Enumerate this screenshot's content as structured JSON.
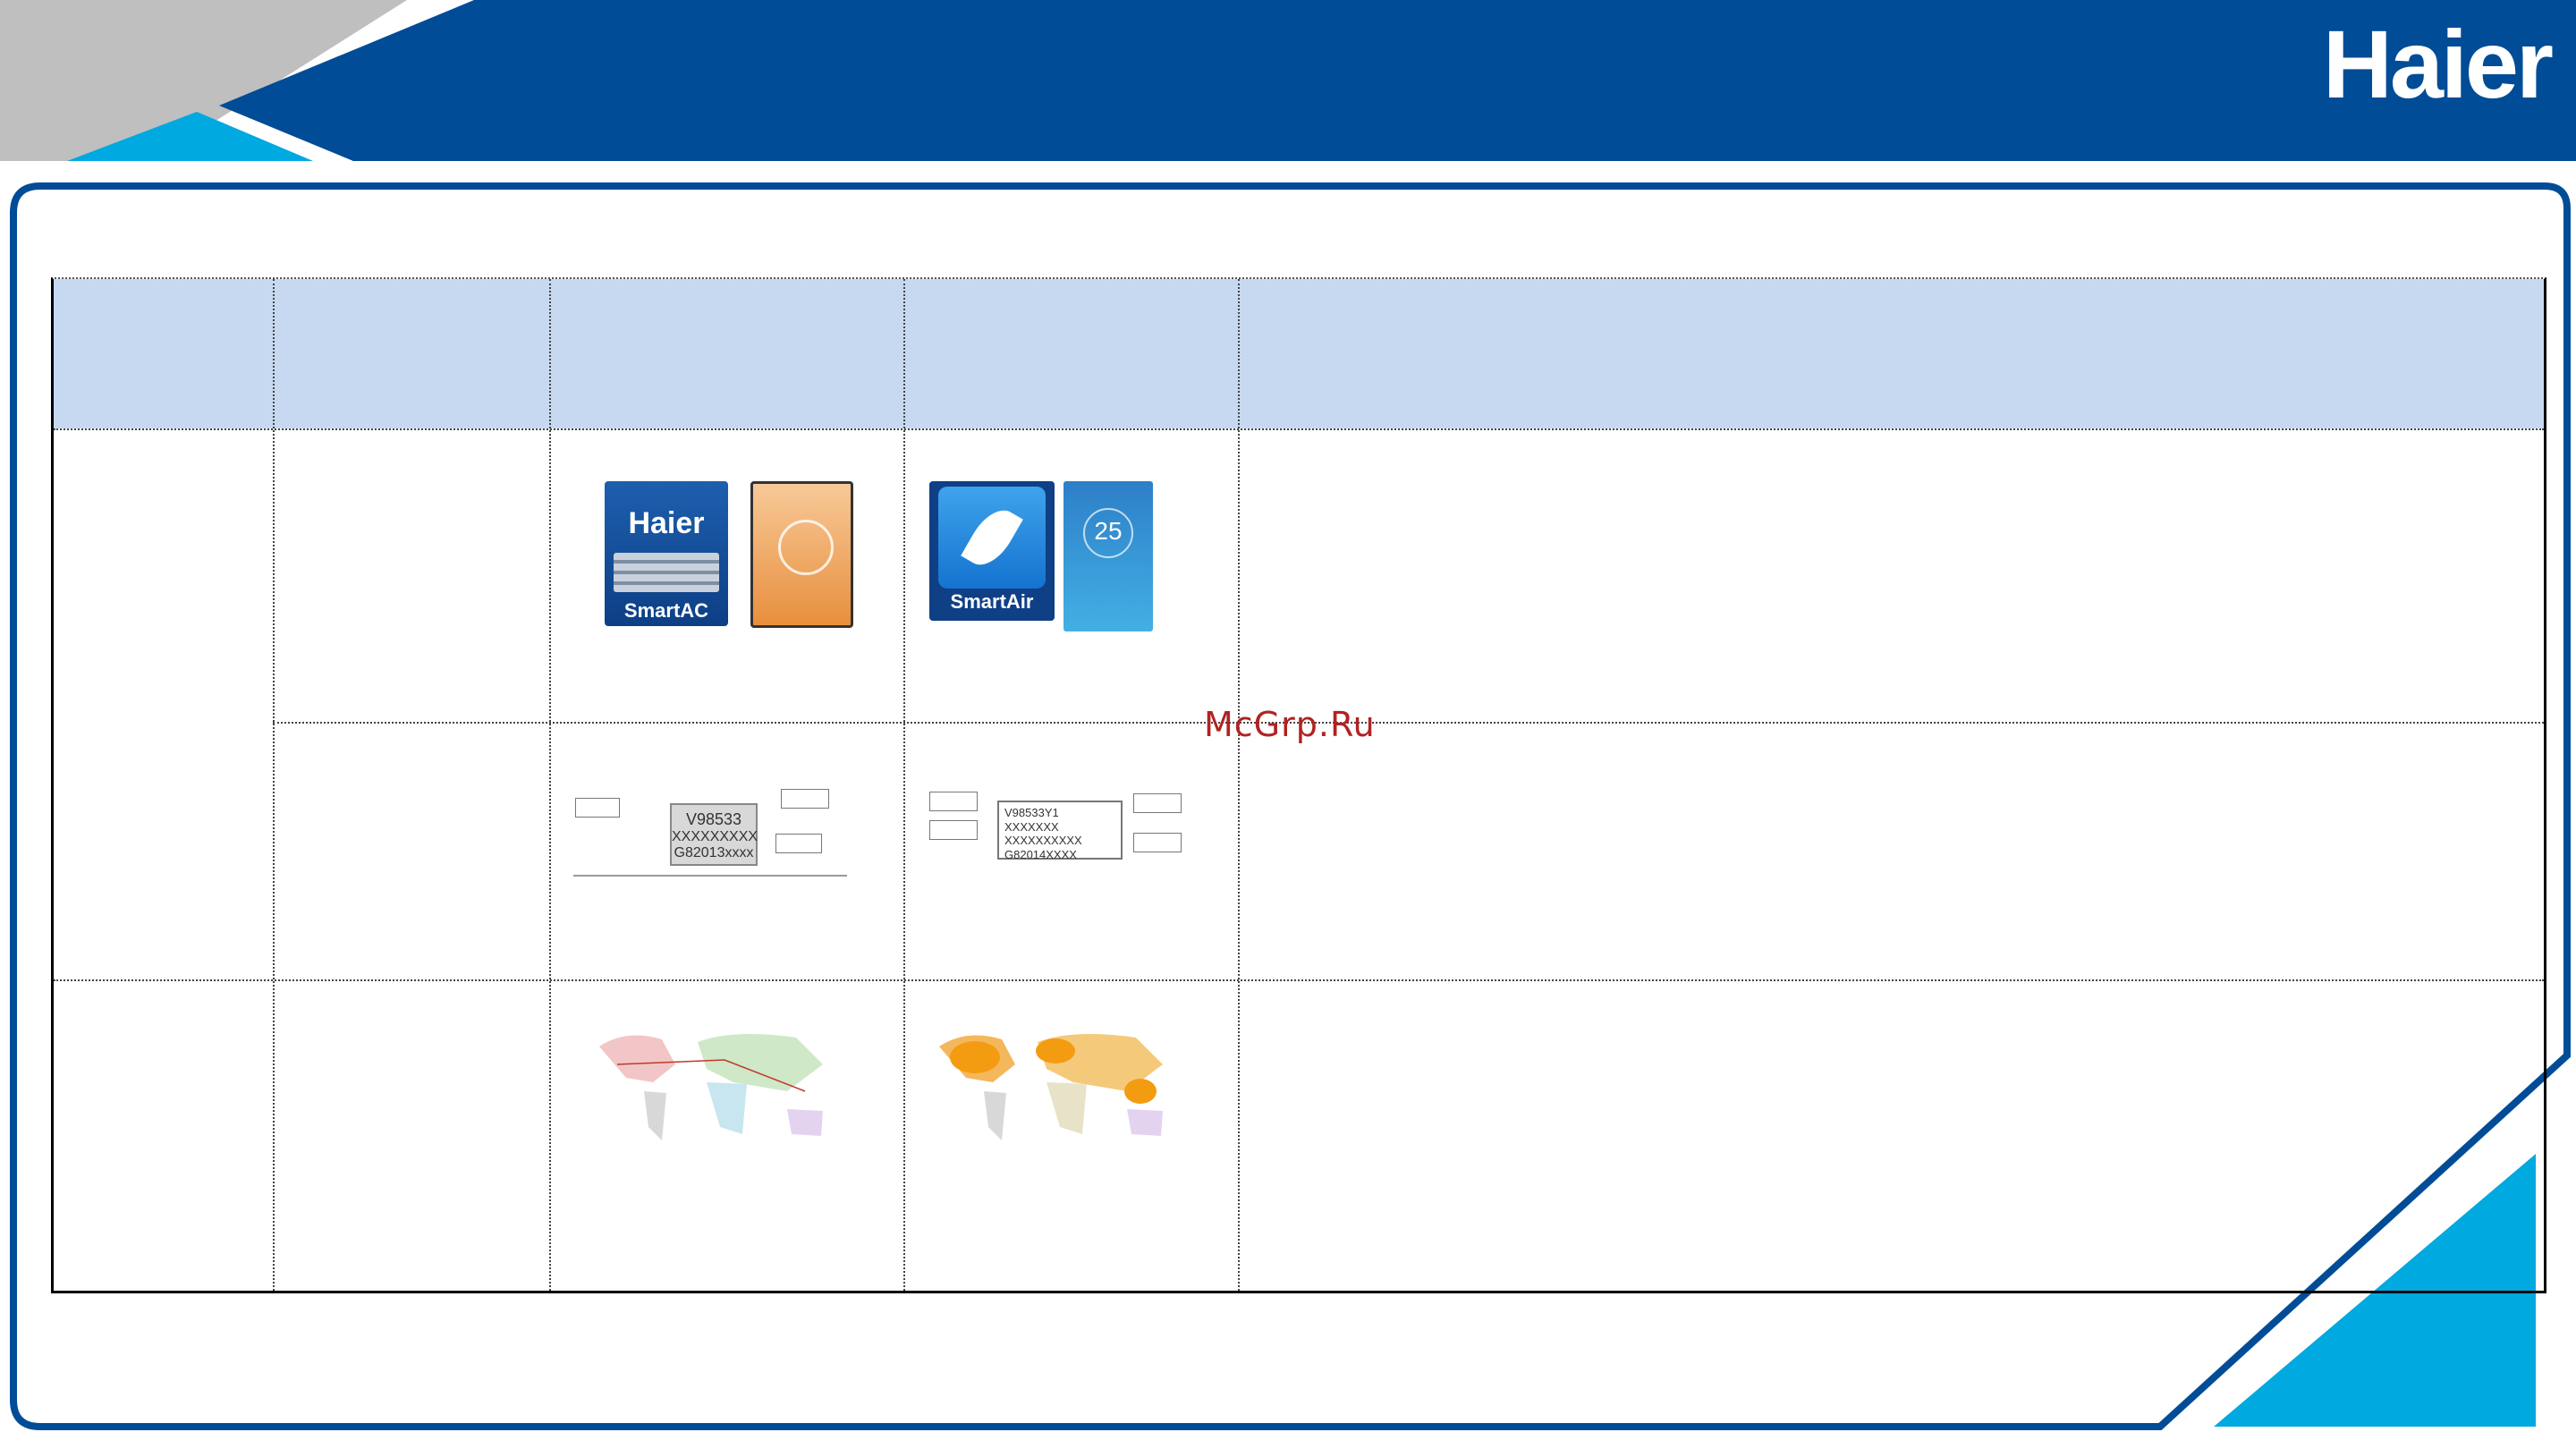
{
  "header": {
    "brand": "Haier"
  },
  "colors": {
    "primary": "#004c97",
    "light_blue": "#00a9e0",
    "gray": "#bfbfbf",
    "table_header": "#c6d9f1",
    "watermark": "#b22222"
  },
  "watermark": "McGrp.Ru",
  "table": {
    "images": [
      {
        "row": 1,
        "column": 3,
        "icons": [
          "haier-smartac-app-icon",
          "smartac-phone-screenshot"
        ],
        "app_icon_text": "Haier",
        "app_icon_caption": "SmartAC"
      },
      {
        "row": 1,
        "column": 4,
        "icons": [
          "smartair-app-icon",
          "smartair-phone-screenshot"
        ],
        "app_icon_caption": "SmartAir",
        "phone_value": "25"
      },
      {
        "row": 2,
        "column": 3,
        "icons": [
          "nameplate-label-diagram"
        ],
        "lines": [
          "V98533",
          "XXXXXXXXX",
          "G82013xxxx"
        ]
      },
      {
        "row": 2,
        "column": 4,
        "icons": [
          "nameplate-label-diagram"
        ],
        "lines": [
          "V98533Y1",
          "XXXXXXX",
          "XXXXXXXXXX",
          "G82014XXXX"
        ]
      },
      {
        "row": 3,
        "column": 3,
        "icons": [
          "world-map-distribution"
        ]
      },
      {
        "row": 3,
        "column": 4,
        "icons": [
          "world-map-distribution"
        ]
      }
    ]
  }
}
